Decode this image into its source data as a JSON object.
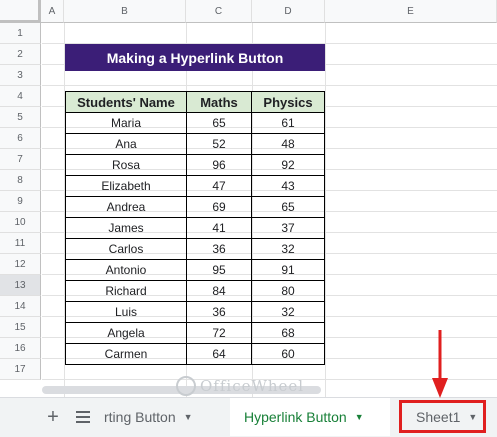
{
  "columns": [
    "A",
    "B",
    "C",
    "D",
    "E"
  ],
  "rows": [
    "1",
    "2",
    "3",
    "4",
    "5",
    "6",
    "7",
    "8",
    "9",
    "10",
    "11",
    "12",
    "13",
    "14",
    "15",
    "16",
    "17"
  ],
  "selected_row": "13",
  "title": "Making a Hyperlink Button",
  "table": {
    "headers": [
      "Students' Name",
      "Maths",
      "Physics"
    ],
    "rows": [
      [
        "Maria",
        "65",
        "61"
      ],
      [
        "Ana",
        "52",
        "48"
      ],
      [
        "Rosa",
        "96",
        "92"
      ],
      [
        "Elizabeth",
        "47",
        "43"
      ],
      [
        "Andrea",
        "69",
        "65"
      ],
      [
        "James",
        "41",
        "37"
      ],
      [
        "Carlos",
        "36",
        "32"
      ],
      [
        "Antonio",
        "95",
        "91"
      ],
      [
        "Richard",
        "84",
        "80"
      ],
      [
        "Luis",
        "36",
        "32"
      ],
      [
        "Angela",
        "72",
        "68"
      ],
      [
        "Carmen",
        "64",
        "60"
      ]
    ]
  },
  "tabs": [
    {
      "label": "rting Button"
    },
    {
      "label": "Hyperlink Button"
    },
    {
      "label": "Sheet1"
    }
  ],
  "watermark": "OfficeWheel",
  "icons": {
    "add": "plus-icon",
    "all_sheets": "list-icon",
    "tab_menu": "caret-down-icon"
  },
  "colors": {
    "title_bg": "#3b1e77",
    "header_bg": "#d9ead3",
    "active_tab": "#188038",
    "highlight": "#e01f1f"
  }
}
